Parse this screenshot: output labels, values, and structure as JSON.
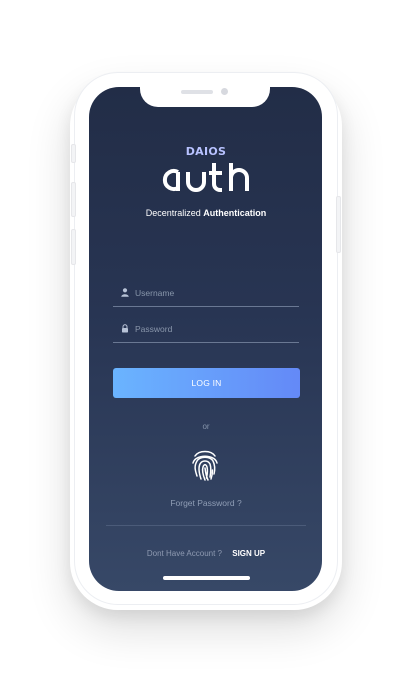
{
  "branding": {
    "brand_name": "DAIOS",
    "product_name": "auth",
    "tagline_prefix": "Decentralized",
    "tagline_bold": "Authentication"
  },
  "form": {
    "username_placeholder": "Username",
    "username_value": "",
    "password_placeholder": "Password",
    "password_value": "",
    "login_label": "LOG IN"
  },
  "alternatives": {
    "or_text": "or",
    "forgot_password": "Forget Password ?"
  },
  "signup": {
    "prompt": "Dont Have Account ?",
    "link_label": "SIGN UP"
  },
  "colors": {
    "screen_top": "#222d47",
    "screen_bottom": "#374867",
    "button_start": "#6ab4ff",
    "button_end": "#6489f7",
    "brand_accent": "#b8c2ff"
  },
  "icons": {
    "username": "user-icon",
    "password": "lock-icon",
    "biometric": "fingerprint-icon"
  }
}
